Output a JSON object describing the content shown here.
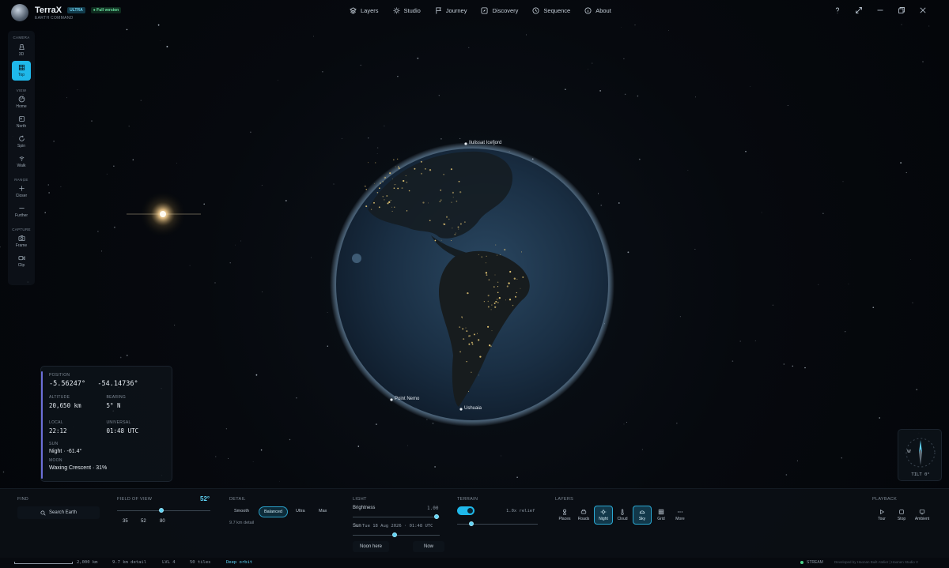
{
  "app": {
    "name": "TerraX",
    "badge_ultra": "ULTRA",
    "badge_full": "Full version",
    "subtitle": "EARTH COMMAND"
  },
  "nav": [
    {
      "label": "Layers",
      "icon": "layers-icon"
    },
    {
      "label": "Studio",
      "icon": "sun-icon"
    },
    {
      "label": "Journey",
      "icon": "flag-icon"
    },
    {
      "label": "Discovery",
      "icon": "compass-icon"
    },
    {
      "label": "Sequence",
      "icon": "clock-icon"
    },
    {
      "label": "About",
      "icon": "info-icon"
    }
  ],
  "window_controls": [
    "help-icon",
    "expand-icon",
    "minimize-icon",
    "restore-icon",
    "close-icon"
  ],
  "left_toolbar": {
    "camera_label": "CAMERA",
    "camera": [
      {
        "label": "3D",
        "icon": "cube-icon",
        "active": false
      },
      {
        "label": "Top",
        "icon": "grid-icon",
        "active": true
      }
    ],
    "view_label": "VIEW",
    "view": [
      {
        "label": "Home",
        "icon": "globe-icon"
      },
      {
        "label": "North",
        "icon": "north-icon"
      },
      {
        "label": "Spin",
        "icon": "rotate-icon"
      },
      {
        "label": "Walk",
        "icon": "walk-icon"
      }
    ],
    "range_label": "RANGE",
    "range": [
      {
        "label": "Closer",
        "icon": "plus-icon"
      },
      {
        "label": "Further",
        "icon": "minus-icon"
      }
    ],
    "capture_label": "CAPTURE",
    "capture": [
      {
        "label": "Frame",
        "icon": "camera-icon"
      },
      {
        "label": "Clip",
        "icon": "video-icon"
      }
    ]
  },
  "globe_labels": {
    "north": "Ilulissat Icefjord",
    "point_nemo": "Point Nemo",
    "ushuaia": "Ushuaia"
  },
  "info": {
    "position_label": "POSITION",
    "lat": "-5.56247°",
    "lon": "-54.14736°",
    "altitude_label": "ALTITUDE",
    "altitude": "20,650 km",
    "bearing_label": "BEARING",
    "bearing": "5° N",
    "local_label": "LOCAL",
    "local": "22:12",
    "universal_label": "UNIVERSAL",
    "universal": "01:48 UTC",
    "sun_label": "SUN",
    "sun": "Night · -61.4°",
    "moon_label": "MOON",
    "moon": "Waxing Crescent · 31%"
  },
  "compass": {
    "west": "W",
    "tilt": "TILT 0°"
  },
  "bottom": {
    "find_label": "FIND",
    "search_placeholder": "Search Earth",
    "fov_label": "FIELD OF VIEW",
    "fov_value": "52°",
    "fov_value_num": 52,
    "fov_ticks": [
      "35",
      "52",
      "80"
    ],
    "detail_label": "DETAIL",
    "detail_options": [
      "Smooth",
      "Balanced",
      "Ultra",
      "Max"
    ],
    "detail_selected": "Balanced",
    "detail_info": "9.7 km detail",
    "light_label": "LIGHT",
    "brightness_label": "Brightness",
    "brightness_value": "1.00",
    "sun_label": "Sun",
    "sun_value": "Tue 18 Aug 2026 · 01:48 UTC",
    "noon_label": "Noon here",
    "now_label": "Now",
    "terrain_label": "TERRAIN",
    "terrain_on": true,
    "relief_value": "1.0x relief",
    "layers_label": "LAYERS",
    "layers": [
      {
        "label": "Places",
        "icon": "place-icon",
        "active": false
      },
      {
        "label": "Roads",
        "icon": "car-icon",
        "active": false
      },
      {
        "label": "Night",
        "icon": "night-icon",
        "active": true
      },
      {
        "label": "Cloud",
        "icon": "thermometer-icon",
        "active": false
      },
      {
        "label": "Sky",
        "icon": "sky-icon",
        "active": true
      },
      {
        "label": "Grid",
        "icon": "grid-icon",
        "active": false
      },
      {
        "label": "More",
        "icon": "more-icon",
        "active": false
      }
    ],
    "playback_label": "PLAYBACK",
    "playback": [
      {
        "label": "Tour",
        "icon": "play-icon"
      },
      {
        "label": "Stop",
        "icon": "stop-icon"
      },
      {
        "label": "Ambient",
        "icon": "monitor-icon"
      }
    ]
  },
  "status": {
    "scale": "2,000 km",
    "detail": "9.7 km detail",
    "level": "LVL 4",
    "tiles": "50 tiles",
    "orbit": "Deep orbit",
    "stream": "STREAM",
    "credit": "Developed by Haonan Built Atelier | Haonen Studio V"
  },
  "colors": {
    "accent": "#1fb8ea",
    "status_green": "#4cd38a",
    "info_bar": "#6c6fd8"
  }
}
